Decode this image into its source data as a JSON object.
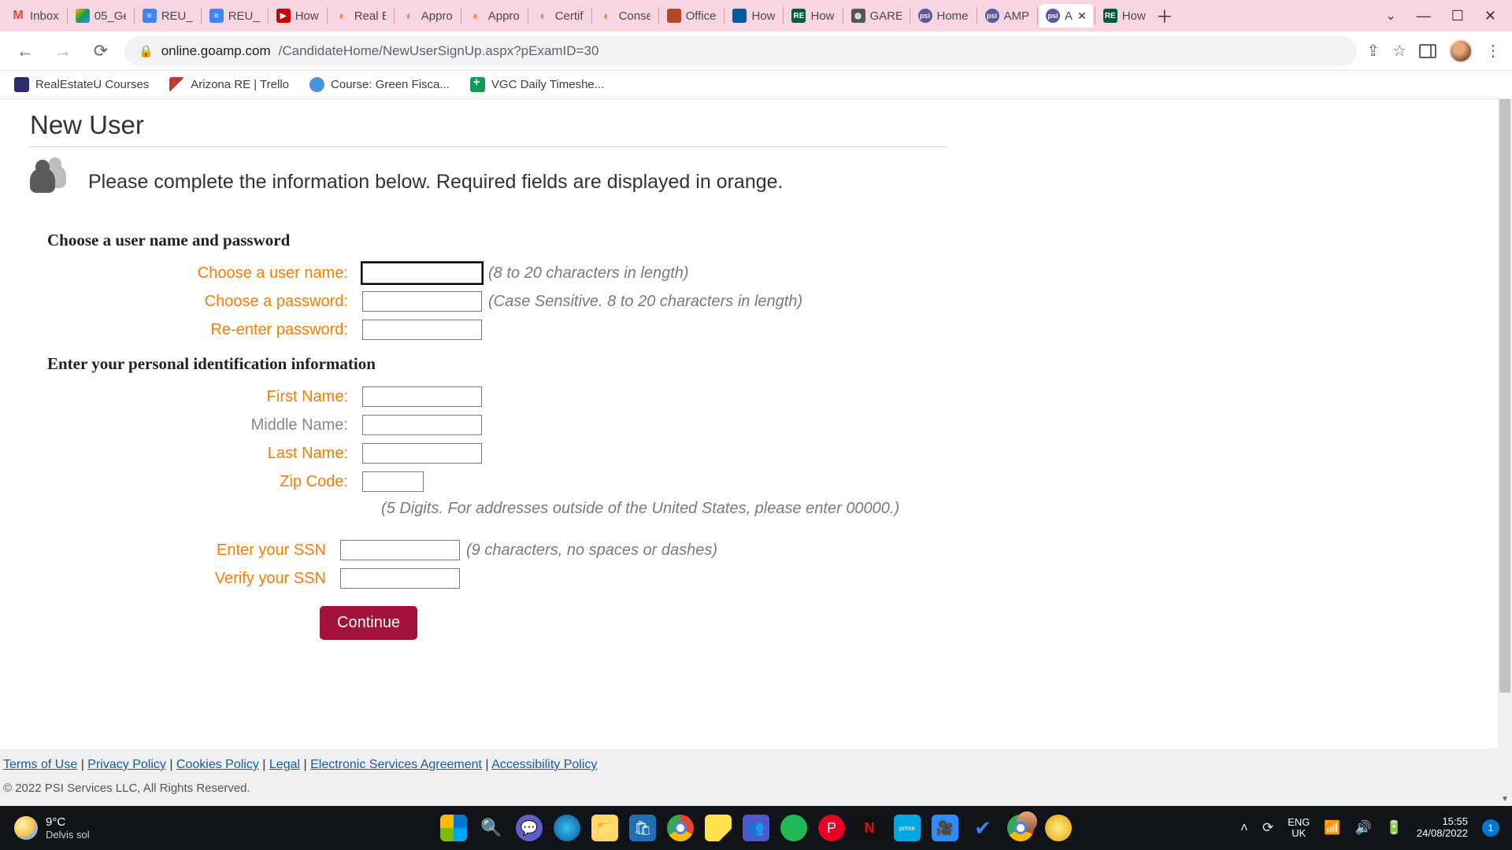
{
  "browser": {
    "tabs": [
      {
        "label": "Inbox",
        "icon": "gmail"
      },
      {
        "label": "05_Ge",
        "icon": "drive"
      },
      {
        "label": "REU_",
        "icon": "docs"
      },
      {
        "label": "REU_",
        "icon": "docs"
      },
      {
        "label": "How",
        "icon": "youtube"
      },
      {
        "label": "Real E",
        "icon": "peach"
      },
      {
        "label": "Appro",
        "icon": "peach"
      },
      {
        "label": "Appro",
        "icon": "peach"
      },
      {
        "label": "Certif",
        "icon": "peach"
      },
      {
        "label": "Conse",
        "icon": "peach"
      },
      {
        "label": "Office",
        "icon": "office"
      },
      {
        "label": "How",
        "icon": "blue"
      },
      {
        "label": "How",
        "icon": "reu"
      },
      {
        "label": "GARE",
        "icon": "web"
      },
      {
        "label": "Home",
        "icon": "psi"
      },
      {
        "label": "AMP",
        "icon": "psi"
      },
      {
        "label": "A",
        "icon": "psi",
        "active": true
      },
      {
        "label": "How",
        "icon": "reu"
      }
    ],
    "url_domain": "online.goamp.com",
    "url_path": "/CandidateHome/NewUserSignUp.aspx?pExamID=30",
    "bookmarks": [
      {
        "label": "RealEstateU Courses",
        "ico": "b1"
      },
      {
        "label": "Arizona RE | Trello",
        "ico": "b2"
      },
      {
        "label": "Course: Green Fisca...",
        "ico": "b3"
      },
      {
        "label": "VGC Daily Timeshe...",
        "ico": "b4"
      }
    ]
  },
  "page": {
    "title": "New User",
    "intro": "Please complete the information below. Required fields are displayed in orange.",
    "section1": "Choose a user name and password",
    "username_label": "Choose a user name:",
    "username_hint": "(8 to 20 characters in length)",
    "password_label": "Choose a password:",
    "password_hint": "(Case Sensitive. 8 to 20 characters in length)",
    "password2_label": "Re-enter password:",
    "section2": "Enter your personal identification information",
    "firstname_label": "First Name:",
    "middlename_label": "Middle Name:",
    "lastname_label": "Last Name:",
    "zip_label": "Zip Code:",
    "zip_hint": "(5 Digits. For addresses outside of the United States, please enter 00000.)",
    "ssn_label": "Enter your SSN",
    "ssn_hint": "(9 characters, no spaces or dashes)",
    "ssn2_label": "Verify your SSN",
    "continue": "Continue",
    "footer_links": [
      "Terms of Use",
      "Privacy Policy",
      "Cookies Policy",
      "Legal",
      "Electronic Services Agreement",
      "Accessibility Policy"
    ],
    "copyright": "© 2022 PSI Services LLC, All Rights Reserved."
  },
  "taskbar": {
    "weather_temp": "9°C",
    "weather_desc": "Delvis sol",
    "lang1": "ENG",
    "lang2": "UK",
    "time": "15:55",
    "date": "24/08/2022",
    "notif": "1"
  }
}
